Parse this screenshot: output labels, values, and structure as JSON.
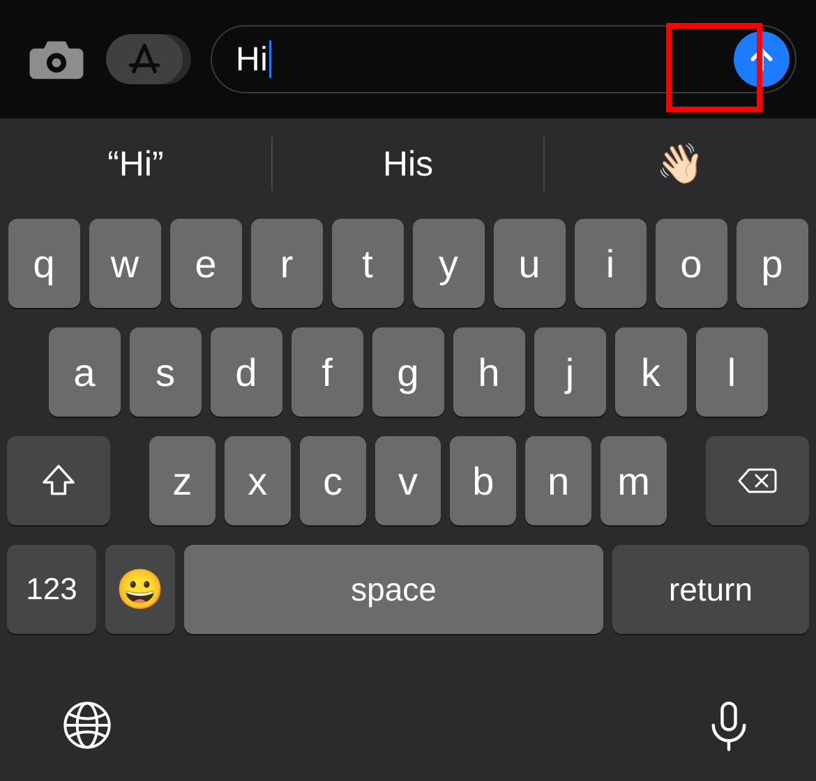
{
  "compose": {
    "input_value": "Hi",
    "send_aria": "Send"
  },
  "suggestions": {
    "items": [
      "Hi",
      "His",
      "👋🏻"
    ]
  },
  "keyboard": {
    "row1": [
      "q",
      "w",
      "e",
      "r",
      "t",
      "y",
      "u",
      "i",
      "o",
      "p"
    ],
    "row2": [
      "a",
      "s",
      "d",
      "f",
      "g",
      "h",
      "j",
      "k",
      "l"
    ],
    "row3": [
      "z",
      "x",
      "c",
      "v",
      "b",
      "n",
      "m"
    ],
    "numeric_label": "123",
    "space_label": "space",
    "return_label": "return",
    "emoji_key": "😀"
  },
  "colors": {
    "accent": "#1c7bff",
    "highlight": "#ff0000"
  }
}
